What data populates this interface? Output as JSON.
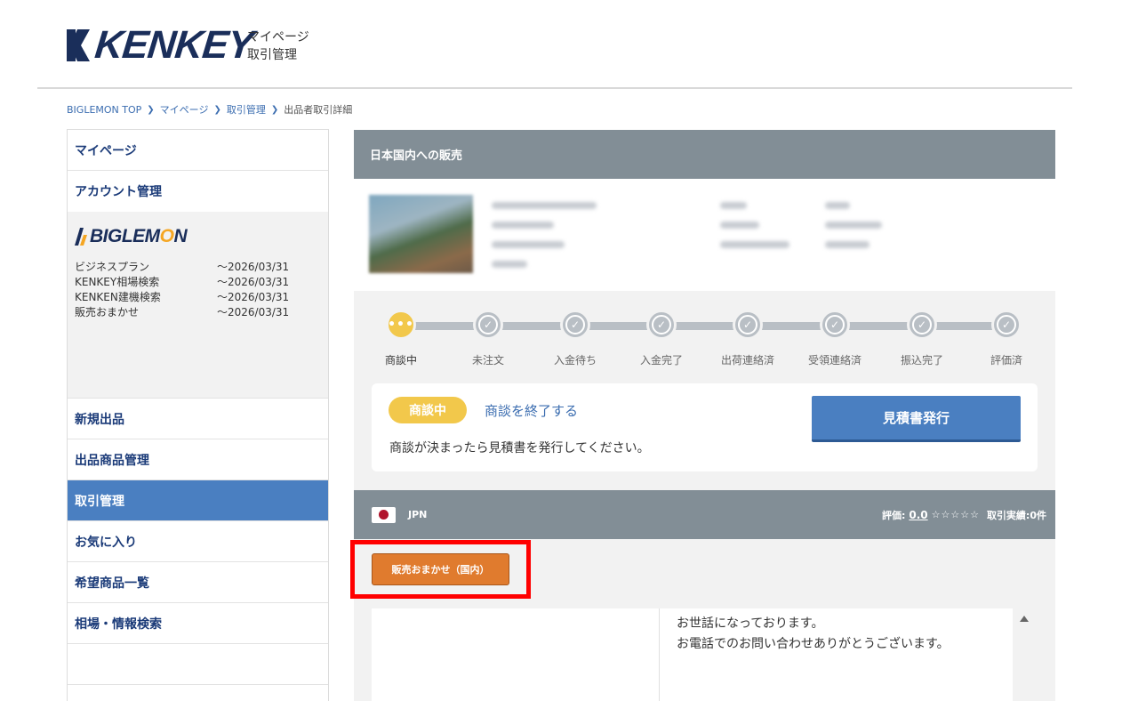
{
  "header": {
    "logo_text": "KENKEY",
    "sub_line1": "マイページ",
    "sub_line2": "取引管理"
  },
  "breadcrumb": [
    {
      "label": "BIGLEMON TOP"
    },
    {
      "label": "マイページ"
    },
    {
      "label": "取引管理"
    },
    {
      "label": "出品者取引詳細"
    }
  ],
  "sidebar": {
    "top_items": [
      {
        "label": "マイページ"
      },
      {
        "label": "アカウント管理"
      }
    ],
    "plan_logo": {
      "text_before": "BIGLEM",
      "accent": "O",
      "text_after": "N"
    },
    "plans": [
      {
        "name": "ビジネスプラン",
        "date": "～2026/03/31"
      },
      {
        "name": "KENKEY相場検索",
        "date": "～2026/03/31"
      },
      {
        "name": "KENKEN建機検索",
        "date": "～2026/03/31"
      },
      {
        "name": "販売おまかせ",
        "date": "～2026/03/31"
      }
    ],
    "items": [
      {
        "label": "新規出品",
        "active": false
      },
      {
        "label": "出品商品管理",
        "active": false
      },
      {
        "label": "取引管理",
        "active": true
      },
      {
        "label": "お気に入り",
        "active": false
      },
      {
        "label": "希望商品一覧",
        "active": false
      },
      {
        "label": "相場・情報検索",
        "active": false
      },
      {
        "label": "",
        "active": false
      }
    ]
  },
  "main": {
    "title": "日本国内への販売",
    "steps": [
      {
        "label": "商談中",
        "active": true
      },
      {
        "label": "未注文",
        "active": false
      },
      {
        "label": "入金待ち",
        "active": false
      },
      {
        "label": "入金完了",
        "active": false
      },
      {
        "label": "出荷連絡済",
        "active": false
      },
      {
        "label": "受領連絡済",
        "active": false
      },
      {
        "label": "振込完了",
        "active": false
      },
      {
        "label": "評価済",
        "active": false
      }
    ],
    "active_step_glyph": "•••",
    "check_glyph": "✓",
    "negotiation": {
      "badge": "商談中",
      "end_link": "商談を終了する",
      "message": "商談が決まったら見積書を発行してください。",
      "quote_button": "見積書発行"
    },
    "partner": {
      "country": "JPN",
      "rating_label": "評価:",
      "rating_value": "0.0",
      "stars": "☆☆☆☆☆",
      "deals_label": "取引実績:",
      "deals_value": "0件"
    },
    "tag": "販売おまかせ（国内）",
    "chat": {
      "lines": [
        "お世話になっております。",
        "お電話でのお問い合わせありがとうございます。"
      ]
    }
  },
  "colors": {
    "brand_navy": "#1a2e5a",
    "accent_blue": "#4a7fc1",
    "header_gray": "#828e96",
    "status_yellow": "#f2c84b",
    "tag_orange": "#e07b2e",
    "highlight_red": "#ff0000"
  }
}
